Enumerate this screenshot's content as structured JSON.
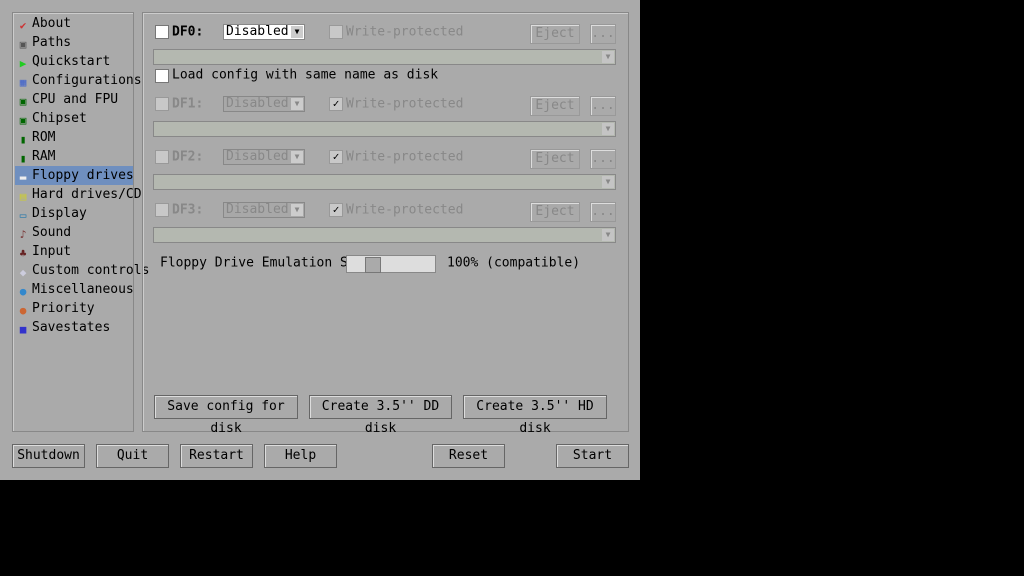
{
  "sidebar": {
    "items": [
      {
        "label": "About",
        "icon": "checkmark-icon"
      },
      {
        "label": "Paths",
        "icon": "folder-icon"
      },
      {
        "label": "Quickstart",
        "icon": "play-icon"
      },
      {
        "label": "Configurations",
        "icon": "config-icon"
      },
      {
        "label": "CPU and FPU",
        "icon": "chip-icon"
      },
      {
        "label": "Chipset",
        "icon": "chip-icon"
      },
      {
        "label": "ROM",
        "icon": "memory-icon"
      },
      {
        "label": "RAM",
        "icon": "memory-icon"
      },
      {
        "label": "Floppy drives",
        "icon": "floppy-drive-icon",
        "selected": true
      },
      {
        "label": "Hard drives/CD",
        "icon": "harddrive-icon"
      },
      {
        "label": "Display",
        "icon": "monitor-icon"
      },
      {
        "label": "Sound",
        "icon": "sound-icon"
      },
      {
        "label": "Input",
        "icon": "joystick-icon"
      },
      {
        "label": "Custom controls",
        "icon": "gamepad-icon"
      },
      {
        "label": "Miscellaneous",
        "icon": "misc-icon"
      },
      {
        "label": "Priority",
        "icon": "priority-icon"
      },
      {
        "label": "Savestates",
        "icon": "save-icon"
      }
    ]
  },
  "drives": [
    {
      "label": "DF0:",
      "type": "Disabled",
      "write_protected": false,
      "enabled": true
    },
    {
      "label": "DF1:",
      "type": "Disabled",
      "write_protected": true,
      "enabled": false
    },
    {
      "label": "DF2:",
      "type": "Disabled",
      "write_protected": true,
      "enabled": false
    },
    {
      "label": "DF3:",
      "type": "Disabled",
      "write_protected": true,
      "enabled": false
    }
  ],
  "write_protected_label": "Write-protected",
  "eject_label": "Eject",
  "browse_label": "...",
  "load_config_label": "Load config with same name as disk",
  "speed": {
    "label": "Floppy Drive Emulation Speed:",
    "value_label": "100% (compatible)",
    "slider_fraction": 0.2
  },
  "disk_buttons": {
    "save": "Save config for disk",
    "dd": "Create 3.5'' DD disk",
    "hd": "Create 3.5'' HD disk"
  },
  "bottom": {
    "shutdown": "Shutdown",
    "quit": "Quit",
    "restart": "Restart",
    "help": "Help",
    "reset": "Reset",
    "start": "Start"
  }
}
